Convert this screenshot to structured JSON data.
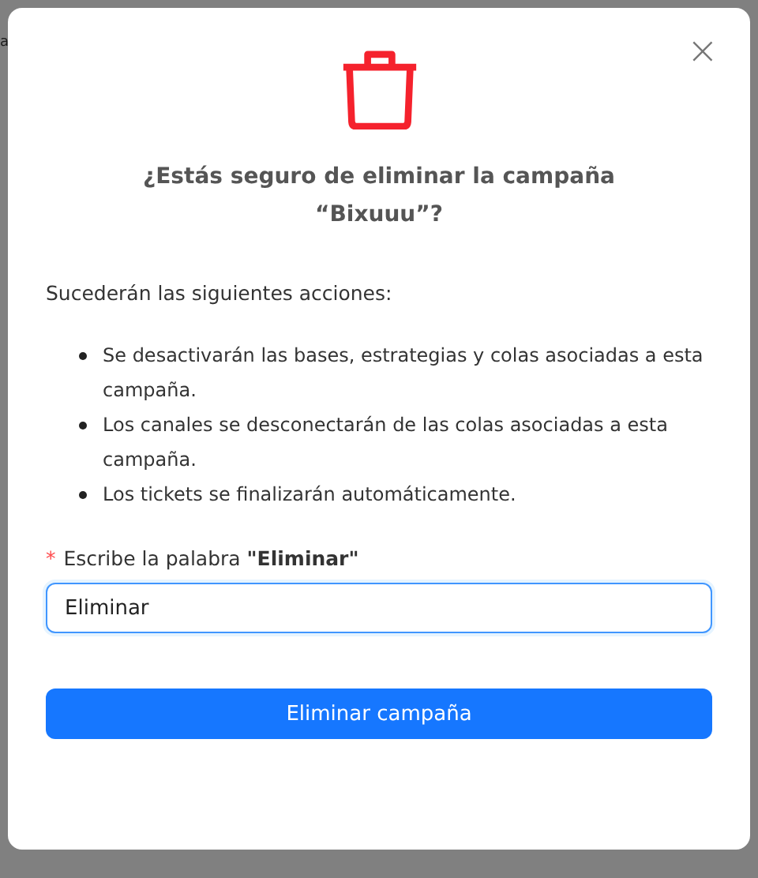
{
  "background": {
    "text_fragment": "a"
  },
  "dialog": {
    "close": "×",
    "title_lines": [
      "¿Estás seguro de eliminar la campaña",
      "“Bixuuu”?"
    ],
    "intro": "Sucederán las siguientes acciones:",
    "actions": [
      "Se desactivarán las bases, estrategias y colas asociadas a esta campaña.",
      "Los canales se desconectarán de las colas asociadas a esta campaña.",
      "Los tickets se finalizarán automáticamente."
    ],
    "field": {
      "required_mark": "*",
      "label": "Escribe la palabra **\"Eliminar\"**",
      "value": "Eliminar",
      "focused": true
    },
    "confirm_button": "Eliminar campaña"
  }
}
